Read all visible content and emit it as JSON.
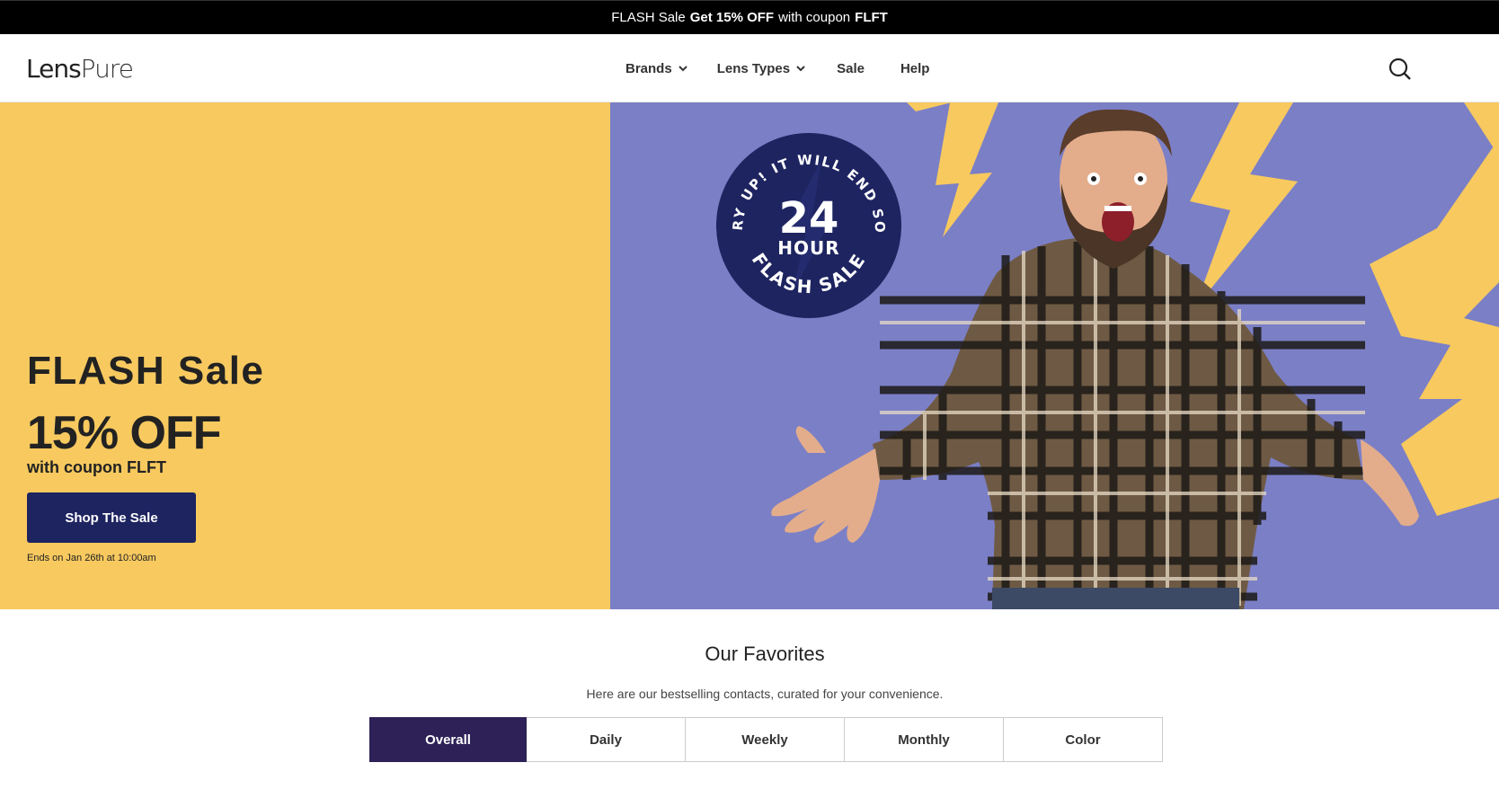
{
  "promo_bar": {
    "prefix": "FLASH Sale",
    "offer": "Get 15% OFF",
    "middle": "with coupon",
    "coupon": "FLFT"
  },
  "header": {
    "logo_lens": "Lens",
    "logo_pure": "Pure",
    "nav": [
      {
        "label": "Brands",
        "has_dropdown": true
      },
      {
        "label": "Lens Types",
        "has_dropdown": true
      },
      {
        "label": "Sale",
        "has_dropdown": false
      },
      {
        "label": "Help",
        "has_dropdown": false
      }
    ],
    "search_icon": "search-icon"
  },
  "hero": {
    "title": "FLASH Sale",
    "discount": "15% OFF",
    "coupon_text": "with coupon FLFT",
    "cta_label": "Shop The Sale",
    "ends_text": "Ends on Jan 26th at 10:00am",
    "badge": {
      "arc_top": "HURRY UP! IT WILL END SOON!",
      "number": "24",
      "unit": "HOUR",
      "arc_bottom": "FLASH SALE"
    },
    "colors": {
      "left_bg": "#f7c95f",
      "right_bg": "#7b7fc6",
      "badge_bg": "#1e2460",
      "cta_bg": "#1e2460"
    }
  },
  "favorites": {
    "title": "Our Favorites",
    "subtitle": "Here are our bestselling contacts, curated for your convenience.",
    "tabs": [
      {
        "label": "Overall",
        "active": true
      },
      {
        "label": "Daily",
        "active": false
      },
      {
        "label": "Weekly",
        "active": false
      },
      {
        "label": "Monthly",
        "active": false
      },
      {
        "label": "Color",
        "active": false
      }
    ],
    "active_color": "#2d2157"
  }
}
